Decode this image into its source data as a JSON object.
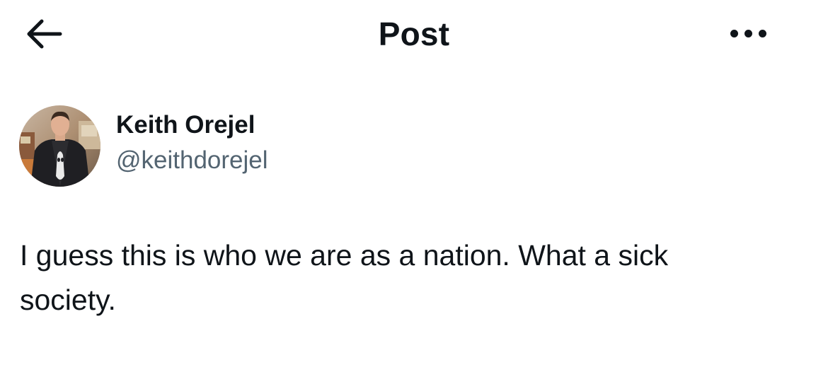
{
  "header": {
    "title": "Post",
    "back_icon": "arrow-left-icon",
    "more_icon": "more-horizontal-icon"
  },
  "author": {
    "display_name": "Keith Orejel",
    "handle": "@keithdorejel"
  },
  "post": {
    "text": "I guess this is who we are as a nation. What a sick\nsociety."
  },
  "colors": {
    "text_primary": "#0f1419",
    "text_secondary": "#536471",
    "background": "#ffffff"
  }
}
